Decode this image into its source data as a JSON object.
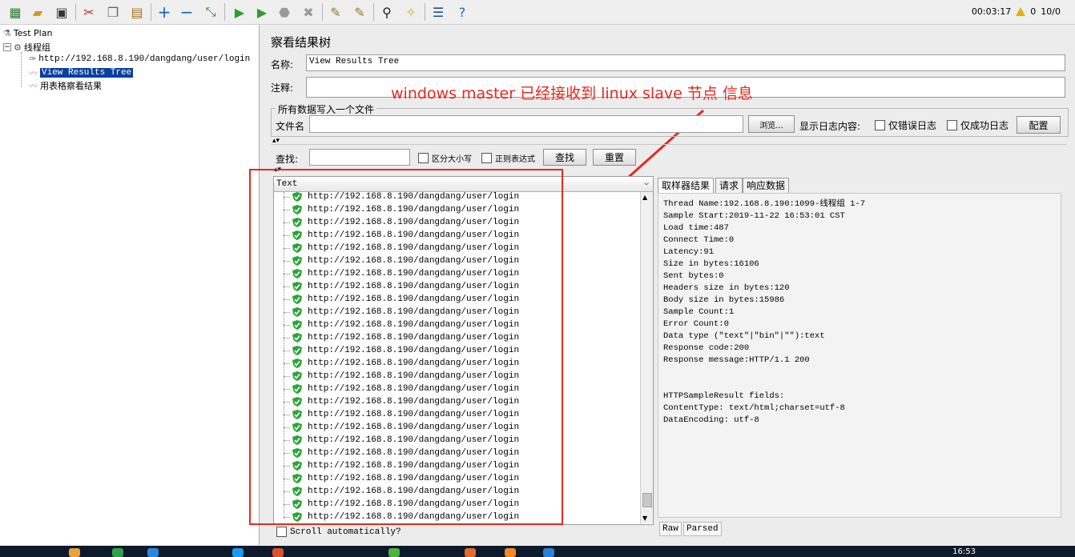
{
  "toolbar": {
    "icons": [
      "templates-icon",
      "open-icon",
      "save-icon",
      "cut-icon",
      "copy-icon",
      "paste-icon",
      "expand-icon",
      "collapse-icon",
      "toggle-icon",
      "start-icon",
      "start-no-pause-icon",
      "stop-icon",
      "shutdown-icon",
      "clear-icon",
      "clear-all-icon",
      "search-icon",
      "reset-search-icon",
      "function-helper-icon",
      "help-icon"
    ],
    "timer": "00:03:17",
    "warning_count": "0",
    "threads": "10/0"
  },
  "tree": {
    "test_plan": "Test Plan",
    "thread_group": "线程组",
    "sampler": "http://192.168.8.190/dangdang/user/login",
    "view_results_tree": "View Results Tree",
    "table_results": "用表格察看结果"
  },
  "panel": {
    "title": "察看结果树",
    "name_label": "名称:",
    "name_value": "View Results Tree",
    "comment_label": "注释:",
    "comment_value": "",
    "file_group_label": "所有数据写入一个文件",
    "filename_label": "文件名",
    "filename_value": "",
    "browse_button": "浏览...",
    "log_label": "显示日志内容:",
    "errors_only": "仅错误日志",
    "success_only": "仅成功日志",
    "configure_button": "配置",
    "search_label": "查找:",
    "search_value": "",
    "case_sensitive": "区分大小写",
    "regex": "正则表达式",
    "find_button": "查找",
    "reset_button": "重置"
  },
  "annotation": "windows  master 已经接收到  linux slave 节点  信息",
  "results": {
    "renderer": "Text",
    "item_label": "http://192.168.8.190/dangdang/user/login",
    "item_count": 26,
    "scroll_label": "Scroll automatically?"
  },
  "detail": {
    "tabs": [
      "取样器结果",
      "请求",
      "响应数据"
    ],
    "lines": [
      "Thread Name:192.168.8.190:1099-线程组 1-7",
      "Sample Start:2019-11-22 16:53:01 CST",
      "Load time:487",
      "Connect Time:0",
      "Latency:91",
      "Size in bytes:16106",
      "Sent bytes:0",
      "Headers size in bytes:120",
      "Body size in bytes:15986",
      "Sample Count:1",
      "Error Count:0",
      "Data type (\"text\"|\"bin\"|\"\"):text",
      "Response code:200",
      "Response message:HTTP/1.1 200",
      "",
      "",
      "HTTPSampleResult fields:",
      "ContentType: text/html;charset=utf-8",
      "DataEncoding: utf-8"
    ],
    "bottom_tabs": [
      "Raw",
      "Parsed"
    ]
  },
  "taskbar": {
    "clock": "16:53"
  }
}
